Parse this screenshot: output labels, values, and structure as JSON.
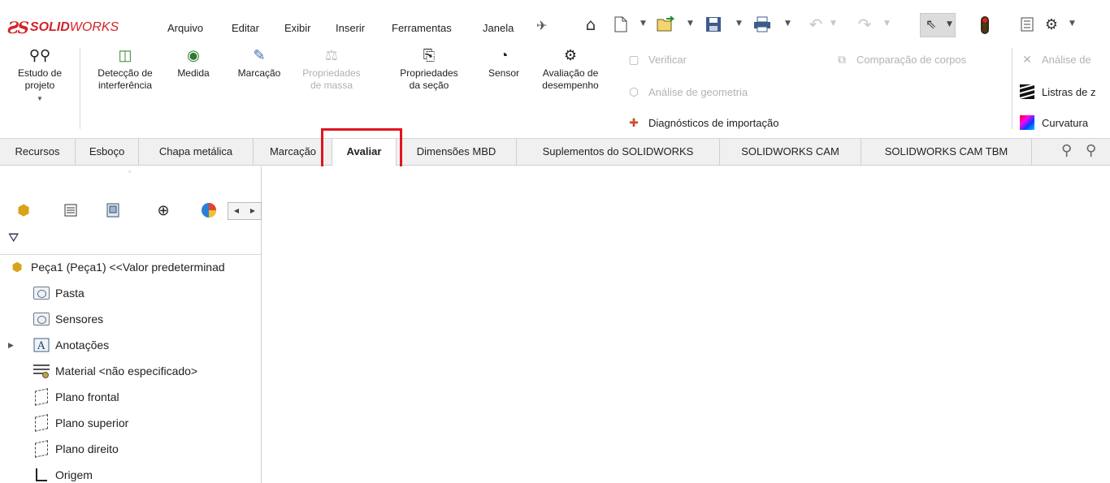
{
  "app": {
    "brand_bold": "SOLID",
    "brand_light": "WORKS"
  },
  "menu": [
    "Arquivo",
    "Editar",
    "Exibir",
    "Inserir",
    "Ferramentas",
    "Janela"
  ],
  "ribbon": {
    "buttons": [
      {
        "label1": "Estudo de",
        "label2": "projeto",
        "icon": "design-study-icon"
      },
      {
        "label1": "Detecção de",
        "label2": "interferência",
        "icon": "interference-detection-icon"
      },
      {
        "label1": "Medida",
        "label2": "",
        "icon": "measure-icon"
      },
      {
        "label1": "Marcação",
        "label2": "",
        "icon": "markup-icon"
      },
      {
        "label1": "Propriedades",
        "label2": "de massa",
        "icon": "mass-properties-icon",
        "disabled": true
      },
      {
        "label1": "Propriedades",
        "label2": "da seção",
        "icon": "section-properties-icon"
      },
      {
        "label1": "Sensor",
        "label2": "",
        "icon": "sensor-icon"
      },
      {
        "label1": "Avaliação de",
        "label2": "desempenho",
        "icon": "performance-evaluation-icon"
      }
    ],
    "small": {
      "verificar": "Verificar",
      "analise_geometria": "Análise de geometria",
      "diagnosticos": "Diagnósticos de importação",
      "comparacao": "Comparação de corpos",
      "analise_de": "Análise de",
      "listras": "Listras de z",
      "curvatura": "Curvatura"
    }
  },
  "tabs": [
    {
      "label": "Recursos"
    },
    {
      "label": "Esboço"
    },
    {
      "label": "Chapa metálica"
    },
    {
      "label": "Marcação"
    },
    {
      "label": "Avaliar",
      "active": true
    },
    {
      "label": "Dimensões MBD"
    },
    {
      "label": "Suplementos do SOLIDWORKS"
    },
    {
      "label": "SOLIDWORKS CAM"
    },
    {
      "label": "SOLIDWORKS CAM TBM"
    }
  ],
  "tree": {
    "root": "Peça1 (Peça1) <<Valor predeterminad",
    "items": [
      {
        "label": "Pasta",
        "icon": "folder-icon"
      },
      {
        "label": "Sensores",
        "icon": "sensors-icon"
      },
      {
        "label": "Anotações",
        "icon": "annotations-icon",
        "expandable": true
      },
      {
        "label": "Material <não especificado>",
        "icon": "material-icon"
      },
      {
        "label": "Plano frontal",
        "icon": "plane-icon"
      },
      {
        "label": "Plano superior",
        "icon": "plane-icon"
      },
      {
        "label": "Plano direito",
        "icon": "plane-icon"
      },
      {
        "label": "Origem",
        "icon": "origin-icon"
      }
    ]
  },
  "colors": {
    "brand": "#d2232a",
    "highlight": "#e0141e",
    "tab_bar": "#f0f0f0"
  }
}
